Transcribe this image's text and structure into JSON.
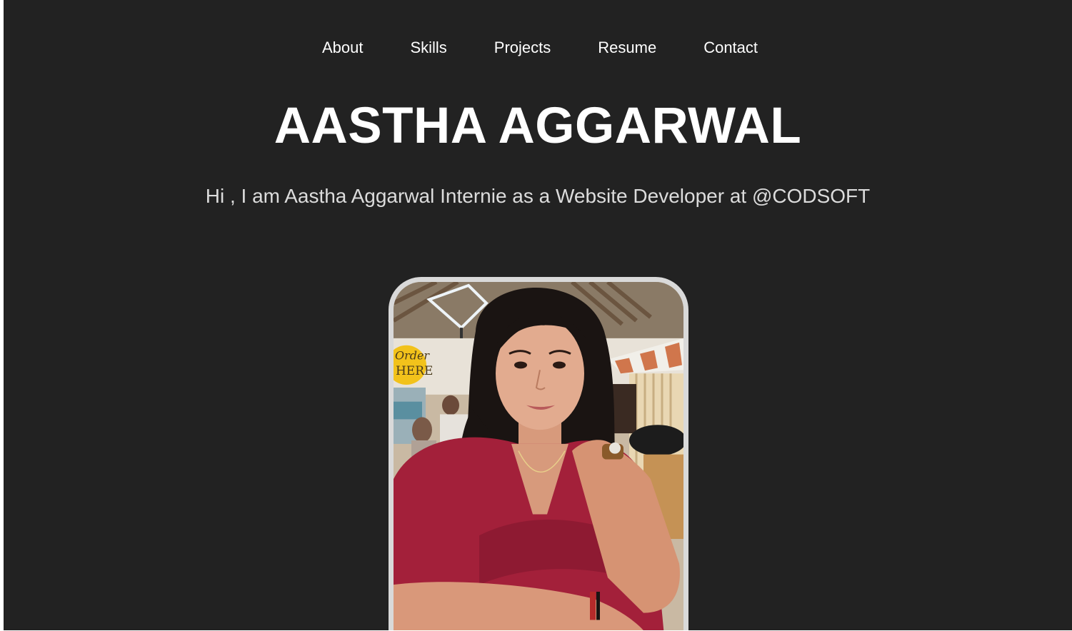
{
  "nav": {
    "items": [
      {
        "label": "About"
      },
      {
        "label": "Skills"
      },
      {
        "label": "Projects"
      },
      {
        "label": "Resume"
      },
      {
        "label": "Contact"
      }
    ]
  },
  "hero": {
    "name": "AASTHA AGGARWAL",
    "tagline": "Hi , I am Aastha Aggarwal Internie as a Website Developer at @CODSOFT",
    "photo_sign_line1": "Order",
    "photo_sign_line2": "HERE"
  },
  "colors": {
    "background": "#222222",
    "text": "#ffffff",
    "tagline": "#dcdcdc",
    "photo_border": "#d9d9d9"
  }
}
